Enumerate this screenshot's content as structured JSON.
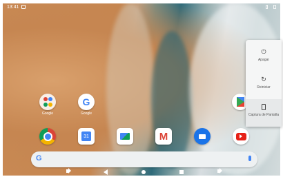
{
  "status_bar": {
    "time": "13:41"
  },
  "apps": {
    "row1": [
      {
        "name": "folder",
        "label": "Google"
      },
      {
        "name": "google",
        "label": "Google"
      }
    ],
    "row2": [
      {
        "name": "chrome",
        "label": ""
      },
      {
        "name": "calendar",
        "label": "31"
      },
      {
        "name": "photos",
        "label": ""
      },
      {
        "name": "gmail",
        "label": "M"
      },
      {
        "name": "duo",
        "label": ""
      },
      {
        "name": "youtube",
        "label": ""
      }
    ],
    "play_store": {
      "label": ""
    }
  },
  "search_bar": {
    "logo": "G"
  },
  "power_menu": {
    "items": [
      {
        "label": "Apagar",
        "icon": "power-icon"
      },
      {
        "label": "Reiniciar",
        "icon": "restart-icon"
      },
      {
        "label": "Captura de Pantalla",
        "icon": "screenshot-icon"
      }
    ]
  },
  "nav_bar": {
    "back": "◀",
    "home": "●",
    "recents": "■"
  }
}
